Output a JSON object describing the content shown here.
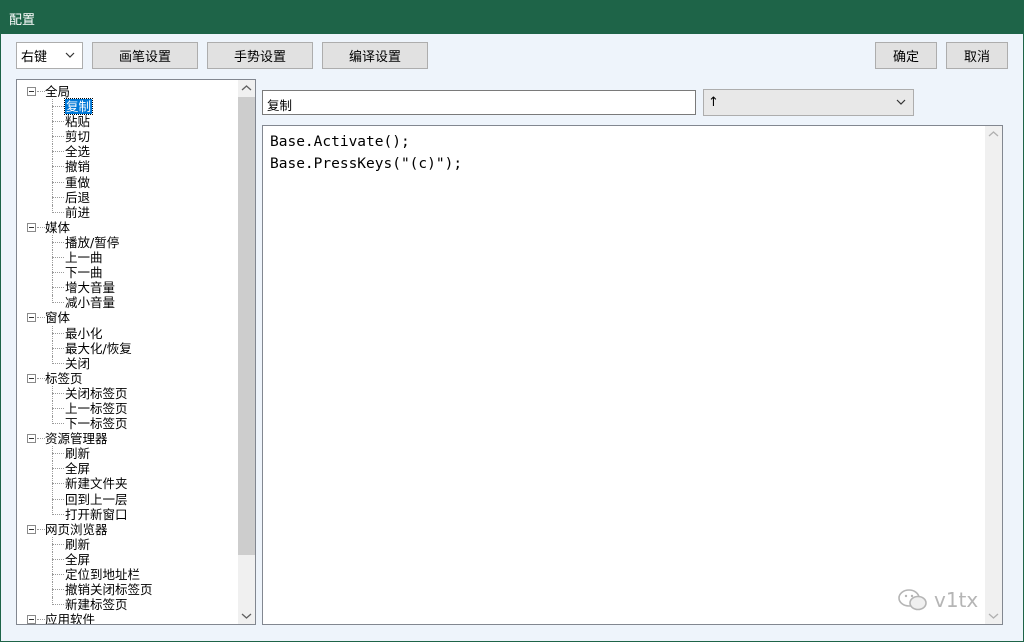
{
  "window": {
    "title": "配置"
  },
  "toolbar": {
    "mouse_button": "右键",
    "pen_settings": "画笔设置",
    "gesture_settings": "手势设置",
    "compile_settings": "编译设置",
    "ok": "确定",
    "cancel": "取消"
  },
  "tree": {
    "groups": [
      {
        "label": "全局",
        "items": [
          "复制",
          "粘贴",
          "剪切",
          "全选",
          "撤销",
          "重做",
          "后退",
          "前进"
        ]
      },
      {
        "label": "媒体",
        "items": [
          "播放/暂停",
          "上一曲",
          "下一曲",
          "增大音量",
          "减小音量"
        ]
      },
      {
        "label": "窗体",
        "items": [
          "最小化",
          "最大化/恢复",
          "关闭"
        ]
      },
      {
        "label": "标签页",
        "items": [
          "关闭标签页",
          "上一标签页",
          "下一标签页"
        ]
      },
      {
        "label": "资源管理器",
        "items": [
          "刷新",
          "全屏",
          "新建文件夹",
          "回到上一层",
          "打开新窗口"
        ]
      },
      {
        "label": "网页浏览器",
        "items": [
          "刷新",
          "全屏",
          "定位到地址栏",
          "撤销关闭标签页",
          "新建标签页"
        ]
      },
      {
        "label": "应用软件",
        "items": []
      }
    ],
    "selected": "复制"
  },
  "editor": {
    "name_value": "复制",
    "gesture_value": "↑",
    "code_lines": [
      "Base.Activate();",
      "Base.PressKeys(\"(c)\");"
    ]
  },
  "watermark": {
    "text": "v1tx",
    "icon": "wechat-icon"
  },
  "colors": {
    "titlebar": "#1e6448",
    "selection": "#0078d7"
  }
}
